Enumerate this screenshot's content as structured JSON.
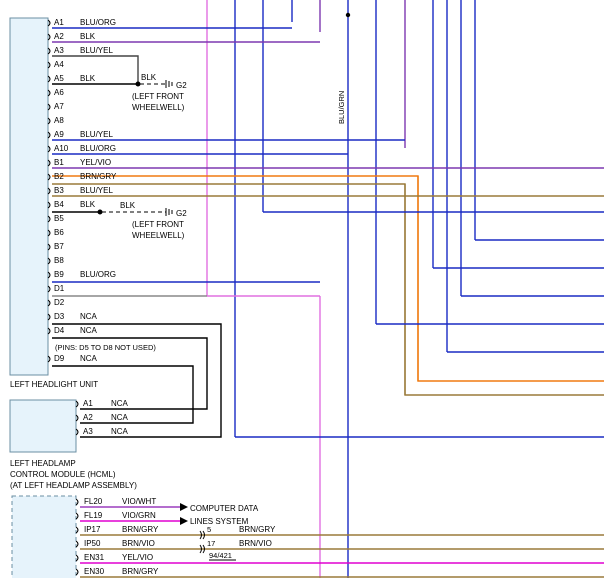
{
  "colors": {
    "background": "#ffffff",
    "connector_fill": "#e6f3fb",
    "connector_border": "#6b8fa3",
    "blue": "#1a2bc4",
    "purple": "#7d38b0",
    "orange": "#f07a10",
    "brown": "#9a7a3a",
    "pink": "#e070e0",
    "magenta": "#e000d0",
    "black": "#000000",
    "gray": "#888888"
  },
  "headlight": {
    "label": "LEFT HEADLIGHT UNIT",
    "pins": [
      {
        "pin": "A1",
        "wire": "BLU/ORG"
      },
      {
        "pin": "A2",
        "wire": "BLK"
      },
      {
        "pin": "A3",
        "wire": "BLU/YEL"
      },
      {
        "pin": "A4",
        "wire": ""
      },
      {
        "pin": "A5",
        "wire": "BLK"
      },
      {
        "pin": "A6",
        "wire": ""
      },
      {
        "pin": "A7",
        "wire": ""
      },
      {
        "pin": "A8",
        "wire": ""
      },
      {
        "pin": "A9",
        "wire": "BLU/YEL"
      },
      {
        "pin": "A10",
        "wire": "BLU/ORG"
      },
      {
        "pin": "B1",
        "wire": "YEL/VIO"
      },
      {
        "pin": "B2",
        "wire": "BRN/GRY"
      },
      {
        "pin": "B3",
        "wire": "BLU/YEL"
      },
      {
        "pin": "B4",
        "wire": "BLK"
      },
      {
        "pin": "B5",
        "wire": ""
      },
      {
        "pin": "B6",
        "wire": ""
      },
      {
        "pin": "B7",
        "wire": ""
      },
      {
        "pin": "B8",
        "wire": ""
      },
      {
        "pin": "B9",
        "wire": "BLU/ORG"
      },
      {
        "pin": "D1",
        "wire": ""
      },
      {
        "pin": "D2",
        "wire": ""
      },
      {
        "pin": "D3",
        "wire": "NCA"
      },
      {
        "pin": "D4",
        "wire": "NCA"
      },
      {
        "pin": "D9",
        "wire": "NCA"
      }
    ],
    "unused_note": "(PINS: D5 TO D8 NOT USED)"
  },
  "grounds": [
    {
      "wire": "BLK",
      "name": "G2",
      "line1": "(LEFT FRONT",
      "line2": "WHEELWELL)"
    },
    {
      "wire": "BLK",
      "name": "G2",
      "line1": "(LEFT FRONT",
      "line2": "WHEELWELL)"
    }
  ],
  "vertical_wire": {
    "label": "BLU/GRN"
  },
  "hcml": {
    "pins": [
      {
        "pin": "A1",
        "wire": "NCA"
      },
      {
        "pin": "A2",
        "wire": "NCA"
      },
      {
        "pin": "A3",
        "wire": "NCA"
      }
    ],
    "label_lines": [
      "LEFT HEADLAMP",
      "CONTROL MODULE (HCML)",
      "(AT LEFT HEADLAMP ASSEMBLY)"
    ]
  },
  "bottom": {
    "pins": [
      {
        "pin": "FL20",
        "wire": "VIO/WHT"
      },
      {
        "pin": "FL19",
        "wire": "VIO/GRN"
      },
      {
        "pin": "IP17",
        "wire": "BRN/GRY"
      },
      {
        "pin": "IP50",
        "wire": "BRN/VIO"
      },
      {
        "pin": "EN31",
        "wire": "YEL/VIO"
      },
      {
        "pin": "EN30",
        "wire": "BRN/GRY"
      }
    ],
    "data_lines": [
      "COMPUTER DATA",
      "LINES SYSTEM"
    ],
    "splice_pins": [
      {
        "pin": "5",
        "wire": "BRN/GRY"
      },
      {
        "pin": "17",
        "wire": "BRN/VIO"
      }
    ],
    "splice_ref": "94/421"
  }
}
